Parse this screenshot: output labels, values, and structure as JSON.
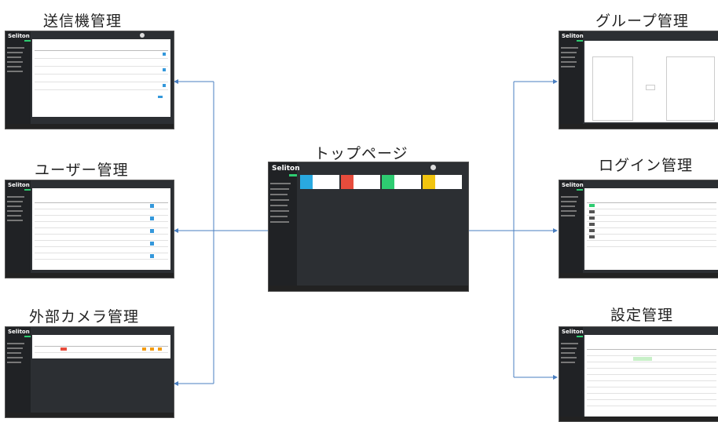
{
  "center": {
    "title": "トップページ"
  },
  "left": [
    {
      "title": "送信機管理"
    },
    {
      "title": "ユーザー管理"
    },
    {
      "title": "外部カメラ管理"
    }
  ],
  "right": [
    {
      "title": "グループ管理"
    },
    {
      "title": "ログイン管理"
    },
    {
      "title": "設定管理"
    }
  ],
  "app": {
    "logo": "Seliton"
  },
  "colors": {
    "connector": "#4a7fc1",
    "accent": "#2ecc71",
    "card_blue": "#29a9e0",
    "card_red": "#e74c3c",
    "card_green": "#2ecc71",
    "card_yellow": "#f1c40f"
  }
}
